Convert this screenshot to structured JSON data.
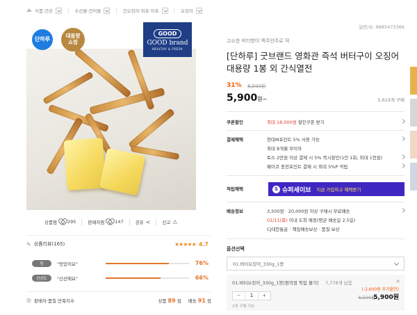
{
  "breadcrumb": {
    "home_icon": "home-icon",
    "items": [
      "식품·건강",
      "수산물·건어물",
      "건오징어·쥐포·어포",
      "오징어"
    ]
  },
  "product_number": "일반/쇼: 8885473366",
  "image": {
    "badge_left": "단하루",
    "badge_right": "대용량\n쇼핑",
    "logo_top": "GOOD",
    "logo_brand": "GOOD brand",
    "logo_tag": "HEALTHY & FRESH"
  },
  "social": {
    "wish_label": "상품찜",
    "wish_count": "295",
    "seller_label": "판매자찜",
    "seller_count": "147",
    "share_label": "공유",
    "report_label": "신고"
  },
  "reviews": {
    "title": "상품리뷰(165)",
    "stars": "★★★★★",
    "score": "4.7",
    "bars": [
      {
        "tag": "맛",
        "question": "\"맛있어요\"",
        "percent": "76%",
        "fill": 0.76
      },
      {
        "tag": "신선도",
        "question": "\"신선해요\"",
        "percent": "66%",
        "fill": 0.66
      }
    ],
    "satisfaction_label": "판매자·품질 만족지수",
    "product_label": "상품",
    "product_score": "89",
    "product_unit": "점",
    "delivery_label": "배송",
    "delivery_score": "91",
    "delivery_unit": "점"
  },
  "product": {
    "subtitle": "고소한 버터향이 맥주안주로 딱",
    "title": "[단하루] 굿브랜드 영화관 즉석 버터구이 오징어 대용량 1봉 외 간식열전",
    "discount": "31%",
    "original_price": "8,500원",
    "price": "5,900",
    "price_unit": "원~",
    "sold": "5,619개 구매"
  },
  "coupon": {
    "label": "쿠폰할인",
    "value_prefix": "최대 18,000원",
    "value_suffix": " 할인쿠폰 받기"
  },
  "payment": {
    "label": "결제혜택",
    "lines": [
      "현대M포인트 5% 사용 가능",
      "최대 8개월 무이자",
      "토스 2만원 이상 결제 시 5% 즉시할인(1인 1회, 최대 1천원)",
      "페이코 충전포인트 결제 시 최대 5%P 적립"
    ]
  },
  "points": {
    "label": "적립혜택",
    "brand_icon": "S",
    "brand": "슈퍼세이브",
    "message": "지금 가입하고 혜택받기"
  },
  "shipping": {
    "label": "배송정보",
    "line1": "3,500원 · 20,000원 이상 구매시 무료배송",
    "line2_date": "01/11(화)",
    "line2_rest": " 이내 도착 예정(평균 배송일 2.5일)",
    "line3": "CJ대한통운 · 책임배송보상 · 품질 보상"
  },
  "options": {
    "label": "옵션선택",
    "selected": "01.버터오징어_330g_1봉",
    "item_name": "01.버터오징어_330g_1봉[편의점 픽업 불가]",
    "item_left": "7,778개 남음",
    "coupon_note": "(-2,600원 추가할인)",
    "minus": "−",
    "qty": "1",
    "plus": "+",
    "limit": "3개 구매 가능",
    "item_orig": "8,500원",
    "item_price": "5,900원"
  },
  "colors": {
    "accent": "#f25c05",
    "star": "#f28c28",
    "supersave": "#3e27c2",
    "badge_blue": "#1e7de0",
    "badge_gold": "#b7883f",
    "logo_navy": "#1f3e86"
  }
}
